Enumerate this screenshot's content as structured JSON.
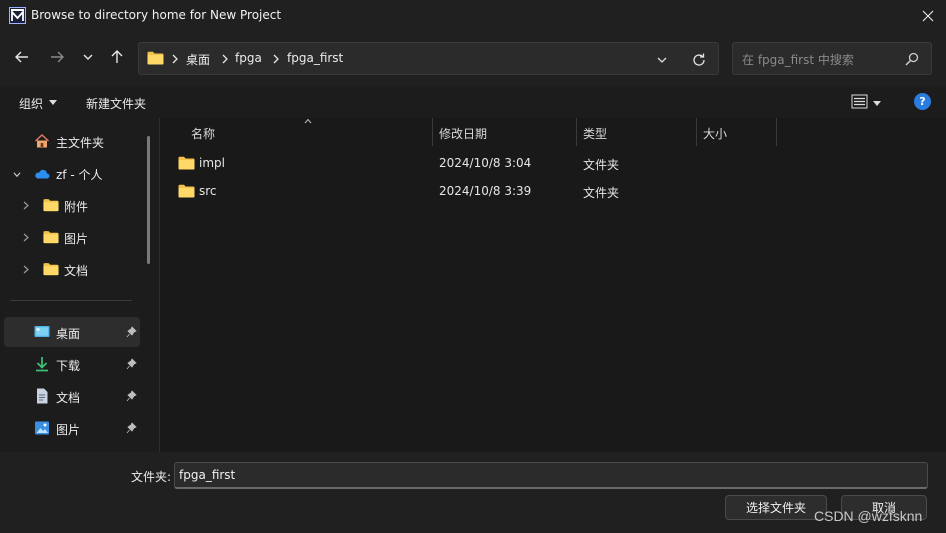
{
  "window": {
    "title": "Browse to directory home for New Project",
    "app_icon": "modelsim-icon"
  },
  "nav": {
    "back_icon": "arrow-left-icon",
    "forward_icon": "arrow-right-icon",
    "recent_icon": "chevron-down-icon",
    "up_icon": "arrow-up-icon",
    "breadcrumbs": [
      "桌面",
      "fpga",
      "fpga_first"
    ],
    "search_placeholder": "在 fpga_first 中搜索"
  },
  "toolbar": {
    "organize_label": "组织",
    "new_folder_label": "新建文件夹",
    "help_label": "?"
  },
  "sidebar": {
    "items": [
      {
        "label": "主文件夹",
        "icon": "home-icon"
      },
      {
        "label": "zf - 个人",
        "icon": "onedrive-icon"
      },
      {
        "label": "附件",
        "icon": "folder-icon"
      },
      {
        "label": "图片",
        "icon": "folder-icon"
      },
      {
        "label": "文档",
        "icon": "folder-icon"
      },
      {
        "label": "桌面",
        "icon": "desktop-icon"
      },
      {
        "label": "下载",
        "icon": "download-icon"
      },
      {
        "label": "文档",
        "icon": "document-icon"
      },
      {
        "label": "图片",
        "icon": "picture-icon"
      }
    ]
  },
  "columns": [
    "名称",
    "修改日期",
    "类型",
    "大小"
  ],
  "files": [
    {
      "name": "impl",
      "modified": "2024/10/8 3:04",
      "type": "文件夹",
      "size": ""
    },
    {
      "name": "src",
      "modified": "2024/10/8 3:39",
      "type": "文件夹",
      "size": ""
    }
  ],
  "footer": {
    "folder_label": "文件夹:",
    "folder_value": "fpga_first",
    "select_button": "选择文件夹",
    "cancel_button": "取消",
    "watermark": "CSDN @wzfsknn"
  },
  "colors": {
    "accent": "#2a7de0",
    "folder": "#f4c24a"
  }
}
